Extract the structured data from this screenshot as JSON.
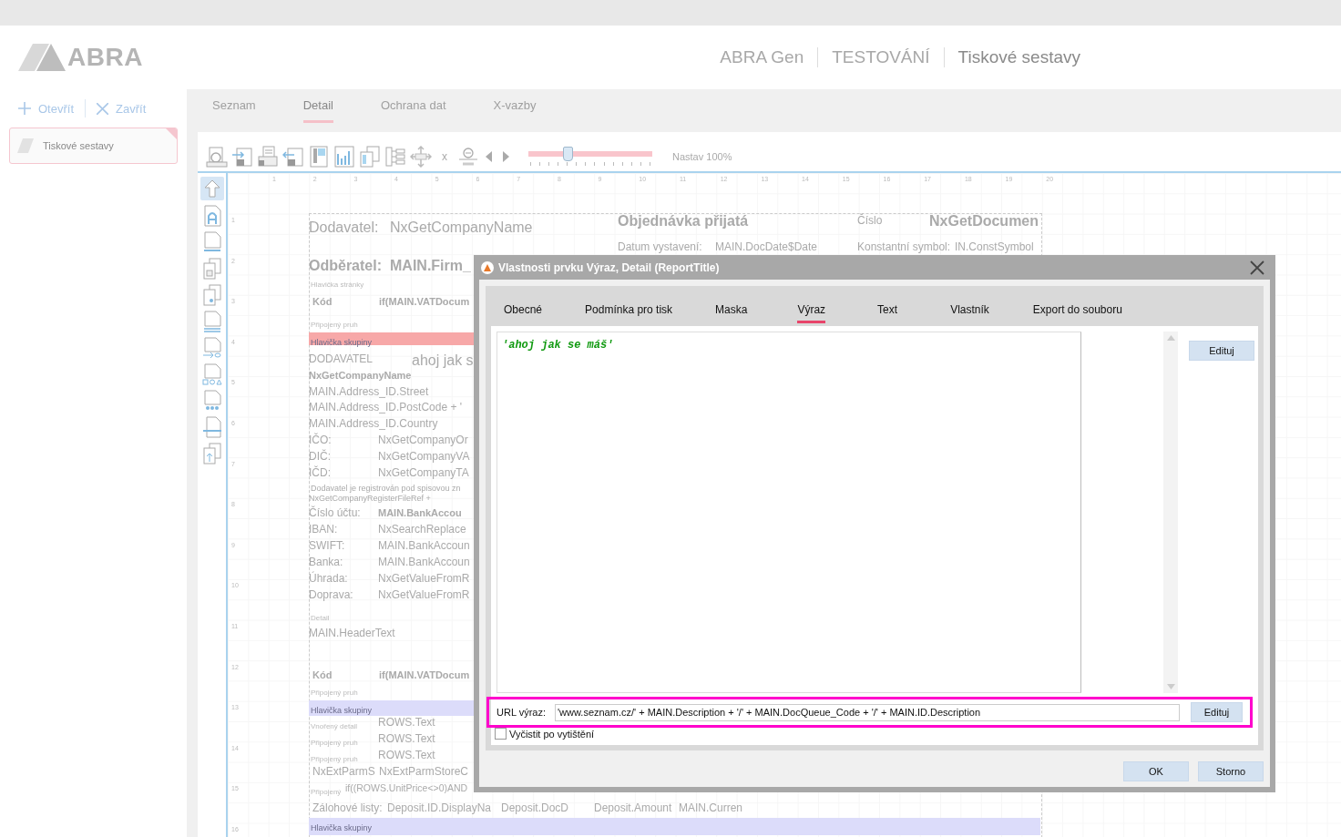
{
  "header": {
    "logo": "ABRA",
    "breadcrumb": [
      "ABRA Gen",
      "TESTOVÁNÍ",
      "Tiskové sestavy"
    ]
  },
  "sidebar": {
    "actions": [
      {
        "label": "Otevřít",
        "kind": "open"
      },
      {
        "label": "Zavřít",
        "kind": "close"
      }
    ],
    "items": [
      {
        "label": "Tiskové sestavy",
        "selected": true
      }
    ]
  },
  "tabs": [
    {
      "label": "Seznam",
      "selected": false
    },
    {
      "label": "Detail",
      "selected": true
    },
    {
      "label": "Ochrana dat",
      "selected": false
    },
    {
      "label": "X-vazby",
      "selected": false
    }
  ],
  "toolbar": {
    "x_button": "x",
    "zoom": {
      "level": 0.31
    },
    "zoom_label": "Nastav 100%"
  },
  "ruler": {
    "columns": [
      "1",
      "2",
      "3",
      "4",
      "5",
      "6",
      "7",
      "8",
      "9",
      "10",
      "11",
      "12",
      "13",
      "14",
      "15",
      "16",
      "17",
      "18",
      "19",
      "20"
    ],
    "rows": [
      "1",
      "2",
      "3",
      "4",
      "5",
      "6",
      "7",
      "8",
      "9",
      "10",
      "11",
      "12",
      "13",
      "14",
      "15",
      "16"
    ]
  },
  "report": {
    "items": [
      {
        "text": "Dodavatel:",
        "kind": "title"
      },
      {
        "text": "NxGetCompanyName",
        "kind": "title"
      },
      {
        "text": "Objednávka přijatá",
        "kind": "heading"
      },
      {
        "text": "Číslo",
        "kind": "label"
      },
      {
        "text": "NxGetDocumen",
        "kind": "heading"
      },
      {
        "text": "Datum vystavení:",
        "kind": "label"
      },
      {
        "text": "MAIN.DocDate$Date",
        "kind": "label"
      },
      {
        "text": "Konstantní symbol:",
        "kind": "label"
      },
      {
        "text": "IN.ConstSymbol",
        "kind": "label"
      },
      {
        "text": "Odběratel:",
        "kind": "heading"
      },
      {
        "text": "MAIN.Firm_",
        "kind": "heading"
      },
      {
        "text": "Hlavička stránky",
        "kind": "caption"
      },
      {
        "text": "Kód",
        "kind": "strong"
      },
      {
        "text": "if(MAIN.VATDocum",
        "kind": "strong"
      },
      {
        "text": "Připojený pruh",
        "kind": "caption"
      },
      {
        "text": "DODAVATEL",
        "kind": "label"
      },
      {
        "text": "ahoj jak s",
        "kind": "big"
      },
      {
        "text": "NxGetCompanyName",
        "kind": "strong"
      },
      {
        "text": "MAIN.Address_ID.Street",
        "kind": "label"
      },
      {
        "text": "MAIN.Address_ID.PostCode + '",
        "kind": "label"
      },
      {
        "text": "MAIN.Address_ID.Country",
        "kind": "label"
      },
      {
        "text": "IČO:",
        "kind": "label"
      },
      {
        "text": "NxGetCompanyOr",
        "kind": "label"
      },
      {
        "text": "DIČ:",
        "kind": "label"
      },
      {
        "text": "NxGetCompanyVA",
        "kind": "label"
      },
      {
        "text": "IČD:",
        "kind": "label"
      },
      {
        "text": "NxGetCompanyTA",
        "kind": "label"
      },
      {
        "text": "Dodavatel je registrován pod spisovou zn",
        "kind": "note"
      },
      {
        "text": "NxGetCompanyRegisterFileRef +",
        "kind": "note"
      },
      {
        "text": "Číslo účtu:",
        "kind": "label"
      },
      {
        "text": "MAIN.BankAccou",
        "kind": "strong"
      },
      {
        "text": "IBAN:",
        "kind": "label"
      },
      {
        "text": "NxSearchReplace",
        "kind": "label"
      },
      {
        "text": "SWIFT:",
        "kind": "label"
      },
      {
        "text": "MAIN.BankAccoun",
        "kind": "label"
      },
      {
        "text": "Banka:",
        "kind": "label"
      },
      {
        "text": "MAIN.BankAccoun",
        "kind": "label"
      },
      {
        "text": "Úhrada:",
        "kind": "label"
      },
      {
        "text": "NxGetValueFromR",
        "kind": "label"
      },
      {
        "text": "Doprava:",
        "kind": "label"
      },
      {
        "text": "NxGetValueFromR",
        "kind": "label"
      },
      {
        "text": "Detail",
        "kind": "caption"
      },
      {
        "text": "MAIN.HeaderText",
        "kind": "label"
      },
      {
        "text": "Kód",
        "kind": "strong"
      },
      {
        "text": "if(MAIN.VATDocum",
        "kind": "strong"
      },
      {
        "text": "Připojený pruh",
        "kind": "caption"
      },
      {
        "text": "Vnořený detail",
        "kind": "caption"
      },
      {
        "text": "ROWS.Text",
        "kind": "label"
      },
      {
        "text": "Připojený pruh",
        "kind": "caption"
      },
      {
        "text": "ROWS.Text",
        "kind": "label"
      },
      {
        "text": "Připojený pruh",
        "kind": "caption"
      },
      {
        "text": "ROWS.Text",
        "kind": "label"
      },
      {
        "text": "NxExtParmS",
        "kind": "label"
      },
      {
        "text": "NxExtParmStoreC",
        "kind": "label"
      },
      {
        "text": "Připojený",
        "kind": "caption"
      },
      {
        "text": "if((ROWS.UnitPrice<>0)AND",
        "kind": "tight"
      },
      {
        "text": "Zálohové listy:",
        "kind": "label"
      },
      {
        "text": "Deposit.ID.DisplayNa",
        "kind": "label"
      },
      {
        "text": "Deposit.DocD",
        "kind": "label"
      },
      {
        "text": "Deposit.Amount",
        "kind": "label"
      },
      {
        "text": "MAIN.Curren",
        "kind": "label"
      }
    ],
    "bands": [
      {
        "caption": "Hlavička skupiny",
        "color": "#f7a8a8"
      },
      {
        "caption": "Hlavička skupiny",
        "color": "#dcdcfa"
      },
      {
        "caption": "Hlavička skupiny",
        "color": "#dcdcfa"
      }
    ]
  },
  "dialog": {
    "title": "Vlastnosti prvku Výraz, Detail (ReportTitle)",
    "tabs": [
      {
        "label": "Obecné",
        "selected": false
      },
      {
        "label": "Podmínka pro tisk",
        "selected": false
      },
      {
        "label": "Maska",
        "selected": false
      },
      {
        "label": "Výraz",
        "selected": true
      },
      {
        "label": "Text",
        "selected": false
      },
      {
        "label": "Vlastník",
        "selected": false
      },
      {
        "label": "Export do souboru",
        "selected": false
      }
    ],
    "expression": "'ahoj jak se máš'",
    "edit_button": "Edituj",
    "url_label": "URL výraz:",
    "url_value": "'www.seznam.cz/' + MAIN.Description + '/' + MAIN.DocQueue_Code + '/' + MAIN.ID.Description",
    "url_edit_button": "Edituj",
    "clear_after_print": {
      "label": "Vyčistit po vytištění",
      "checked": false
    },
    "buttons": [
      "OK",
      "Storno"
    ]
  }
}
